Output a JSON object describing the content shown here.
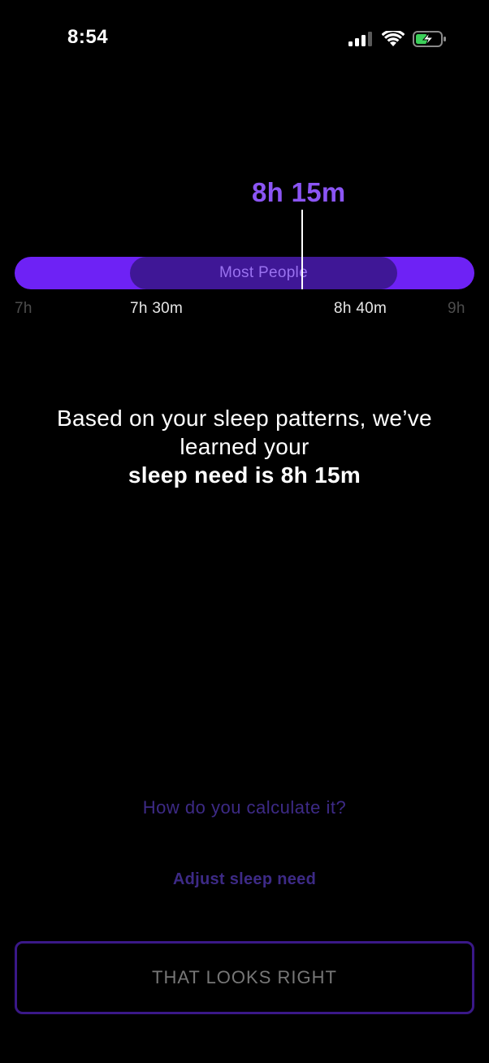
{
  "status_bar": {
    "time": "8:54",
    "icons": [
      "cellular-signal-icon",
      "wifi-icon",
      "battery-charging-icon"
    ],
    "battery_color": "#3ccf5a"
  },
  "sleep_range": {
    "current_value_label": "8h 15m",
    "band_label": "Most People",
    "ticks": {
      "min": "7h",
      "band_start": "7h 30m",
      "band_end": "8h 40m",
      "max": "9h"
    },
    "accent_color": "#6e22f5",
    "band_color": "#3f1796",
    "value_color": "#8b55f4"
  },
  "message": {
    "line1": "Based on your sleep patterns, we’ve",
    "line2": "learned your",
    "line3": "sleep need is 8h 15m"
  },
  "actions": {
    "how_calculate": "How do you calculate it?",
    "adjust": "Adjust sleep need",
    "confirm": "THAT LOOKS RIGHT"
  }
}
